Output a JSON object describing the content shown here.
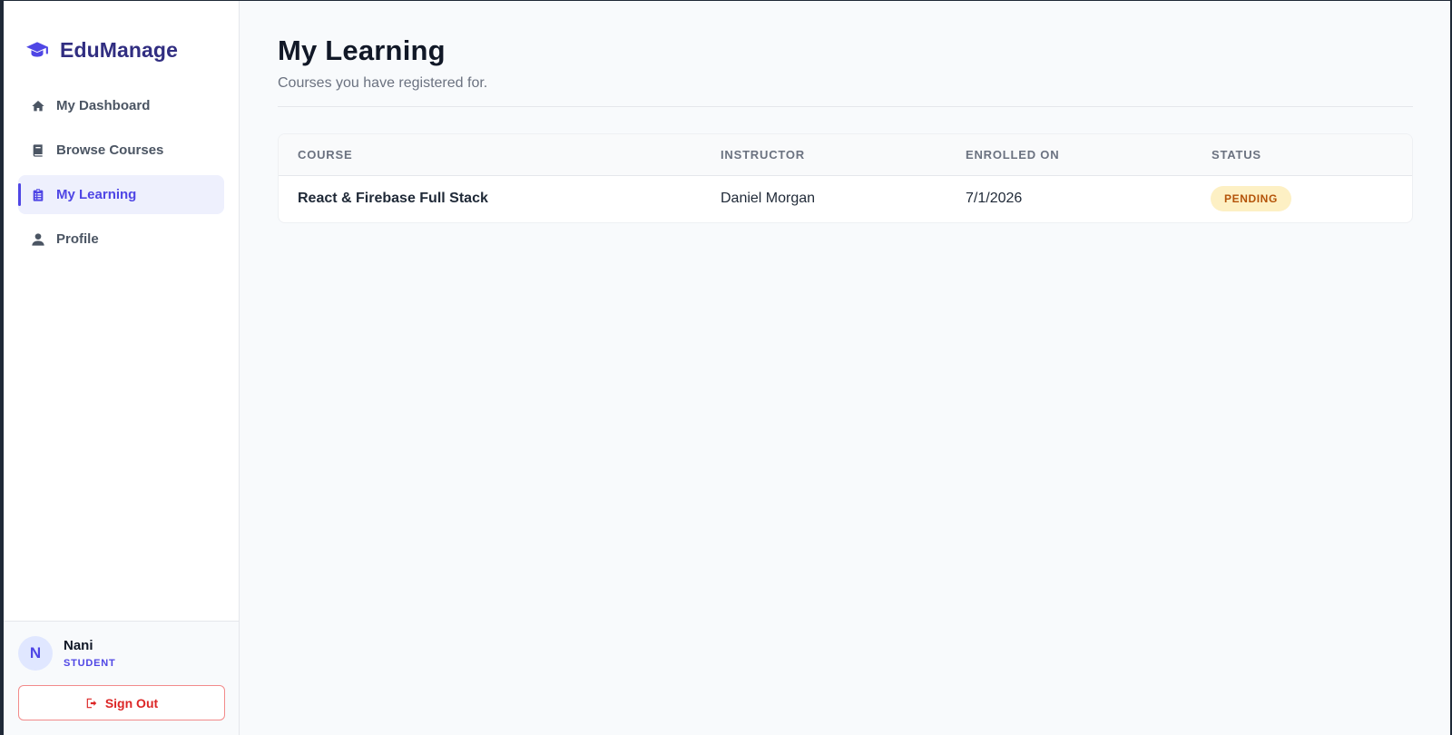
{
  "brand": {
    "name": "EduManage",
    "icon": "graduation-cap-icon"
  },
  "sidebar": {
    "items": [
      {
        "label": "My Dashboard",
        "icon": "home-icon",
        "active": false
      },
      {
        "label": "Browse Courses",
        "icon": "book-icon",
        "active": false
      },
      {
        "label": "My Learning",
        "icon": "clipboard-list-icon",
        "active": true
      },
      {
        "label": "Profile",
        "icon": "user-icon",
        "active": false
      }
    ]
  },
  "user": {
    "initial": "N",
    "name": "Nani",
    "role": "STUDENT"
  },
  "signout": {
    "label": "Sign Out",
    "icon": "sign-out-icon"
  },
  "main": {
    "title": "My Learning",
    "subtitle": "Courses you have registered for."
  },
  "table": {
    "columns": [
      "COURSE",
      "INSTRUCTOR",
      "ENROLLED ON",
      "STATUS"
    ],
    "rows": [
      {
        "course": "React & Firebase Full Stack",
        "instructor": "Daniel Morgan",
        "enrolled": "7/1/2026",
        "status": "PENDING"
      }
    ]
  },
  "colors": {
    "accent": "#4f46e5",
    "brand_text": "#312e81",
    "danger": "#dc2626",
    "pending_bg": "#fdf0c4",
    "pending_text": "#b45309"
  }
}
